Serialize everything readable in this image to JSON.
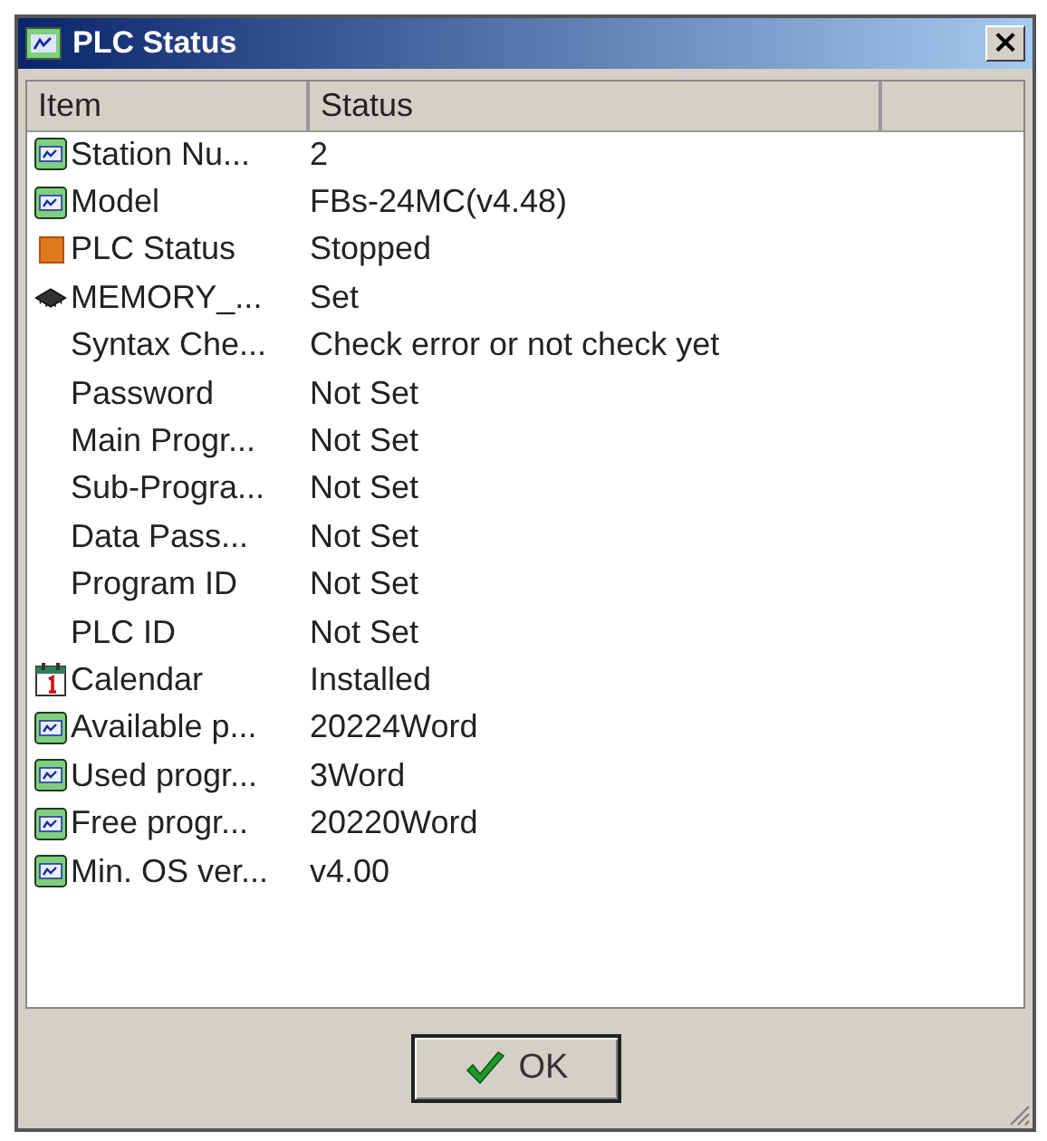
{
  "window": {
    "title": "PLC Status",
    "close": "×"
  },
  "table": {
    "columns": [
      "Item",
      "Status"
    ],
    "rows": [
      {
        "kind": "module",
        "item": "Station Nu...",
        "status": "2"
      },
      {
        "kind": "module",
        "item": "Model",
        "status": "FBs-24MC(v4.48)"
      },
      {
        "kind": "status",
        "item": "PLC Status",
        "status": "Stopped"
      },
      {
        "kind": "chip",
        "item": "MEMORY_...",
        "status": "Set"
      },
      {
        "kind": "plain",
        "item": "Syntax Che...",
        "status": "Check error or not check yet"
      },
      {
        "kind": "plain",
        "item": "Password",
        "status": "Not Set"
      },
      {
        "kind": "plain",
        "item": "Main Progr...",
        "status": "Not Set"
      },
      {
        "kind": "plain",
        "item": "Sub-Progra...",
        "status": "Not Set"
      },
      {
        "kind": "plain",
        "item": "Data Pass...",
        "status": "Not Set"
      },
      {
        "kind": "plain",
        "item": "Program ID",
        "status": "Not Set"
      },
      {
        "kind": "plain",
        "item": "PLC ID",
        "status": "Not Set"
      },
      {
        "kind": "calendar",
        "item": "Calendar",
        "status": "Installed"
      },
      {
        "kind": "module",
        "item": "Available p...",
        "status": "20224Word"
      },
      {
        "kind": "module",
        "item": "Used progr...",
        "status": "3Word"
      },
      {
        "kind": "module",
        "item": "Free progr...",
        "status": "20220Word"
      },
      {
        "kind": "module",
        "item": "Min. OS ver...",
        "status": "v4.00"
      }
    ]
  },
  "buttons": [
    {
      "label": "OK"
    }
  ]
}
